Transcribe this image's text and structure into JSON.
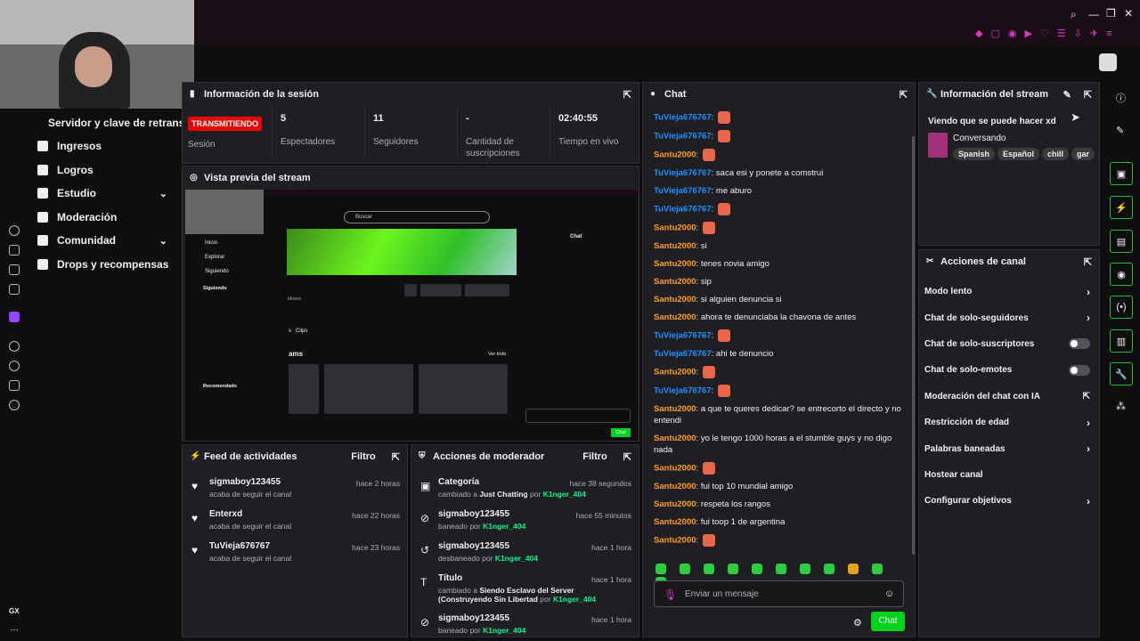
{
  "sidebar": {
    "header": "Servidor y clave de retransm",
    "items": [
      {
        "label": "Ingresos",
        "icon": "revenue-icon"
      },
      {
        "label": "Logros",
        "icon": "trophy-icon"
      },
      {
        "label": "Estudio",
        "icon": "studio-icon",
        "expandable": true
      },
      {
        "label": "Moderación",
        "icon": "wrench-icon"
      },
      {
        "label": "Comunidad",
        "icon": "community-icon",
        "expandable": true
      },
      {
        "label": "Drops y recompensas",
        "icon": "drops-icon"
      }
    ]
  },
  "session": {
    "title": "Información de la sesión",
    "badge": "TRANSMITIENDO",
    "badge_label": "Sesión",
    "stats": [
      {
        "value": "5",
        "label": "Espectadores"
      },
      {
        "value": "11",
        "label": "Seguidores"
      },
      {
        "value": "-",
        "label": "Cantidad de suscripciones"
      },
      {
        "value": "02:40:55",
        "label": "Tiempo en vivo"
      }
    ]
  },
  "preview": {
    "title": "Vista previa del stream",
    "search": "Buscar",
    "nav": [
      "Inicio",
      "Explorar",
      "Siguiendo"
    ],
    "section1": "Siguiendo",
    "section2": "Recomendado",
    "chat": "Chat",
    "clips": "Clips",
    "ams": "ams",
    "ver_todo": "Ver todo",
    "viewers": "idores",
    "chat_btn": "Chat"
  },
  "feed": {
    "title": "Feed de actividades",
    "filter": "Filtro",
    "rows": [
      {
        "name": "sigmaboy123455",
        "desc": "acaba de seguir el canal",
        "time": "hace 2 horas"
      },
      {
        "name": "Enterxd",
        "desc": "acaba de seguir el canal",
        "time": "hace 22 horas"
      },
      {
        "name": "TuVieja676767",
        "desc": "acaba de seguir el canal",
        "time": "hace 23 horas"
      }
    ]
  },
  "modactions": {
    "title": "Acciones de moderador",
    "filter": "Filtro",
    "rows": [
      {
        "name": "Categoría",
        "desc_pre": "cambiado a ",
        "desc_hl": "Just Chatting",
        "desc_mid": " por ",
        "desc_by": "K1nger_404",
        "time": "hace 38 segundos"
      },
      {
        "name": "sigmaboy123455",
        "desc_pre": "baneado por ",
        "desc_by": "K1nger_404",
        "time": "hace 55 minutos"
      },
      {
        "name": "sigmaboy123455",
        "desc_pre": "desbaneado por ",
        "desc_by": "K1nger_404",
        "time": "hace 1 hora"
      },
      {
        "name": "Título",
        "desc_pre": "cambiado a ",
        "desc_hl": "Siendo Esclavo del Server",
        "desc_line2": "(Construyendo Sin Libertad",
        "desc_mid": " por ",
        "desc_by": "K1nger_404",
        "time": "hace 1 hora"
      },
      {
        "name": "sigmaboy123455",
        "desc_pre": "baneado por ",
        "desc_by": "K1nger_404",
        "time": "hace 1 hora"
      }
    ]
  },
  "chat": {
    "title": "Chat",
    "placeholder": "Enviar un mensaje",
    "send": "Chat",
    "messages": [
      {
        "user": "TuVieja676767",
        "text": "",
        "color": "#1e90ff",
        "emote": true
      },
      {
        "user": "TuVieja676767",
        "text": "",
        "color": "#1e90ff",
        "emote": true
      },
      {
        "user": "Santu2000",
        "text": "",
        "color": "#ff9f1c",
        "emote": true
      },
      {
        "user": "TuVieja676767",
        "text": "saca esi y ponete a comstrui",
        "color": "#1e90ff"
      },
      {
        "user": "TuVieja676767",
        "text": "me aburo",
        "color": "#1e90ff"
      },
      {
        "user": "TuVieja676767",
        "text": "",
        "color": "#1e90ff",
        "emote": true
      },
      {
        "user": "Santu2000",
        "text": "",
        "color": "#ff9f1c",
        "emote": true
      },
      {
        "user": "Santu2000",
        "text": "si",
        "color": "#ff9f1c"
      },
      {
        "user": "Santu2000",
        "text": "tenes novia amigo",
        "color": "#ff9f1c"
      },
      {
        "user": "Santu2000",
        "text": "sip",
        "color": "#ff9f1c"
      },
      {
        "user": "Santu2000",
        "text": "si alguien denuncia si",
        "color": "#ff9f1c"
      },
      {
        "user": "Santu2000",
        "text": "ahora te denunciaba la chavona de antes",
        "color": "#ff9f1c"
      },
      {
        "user": "TuVieja676767",
        "text": "",
        "color": "#1e90ff",
        "emote": true
      },
      {
        "user": "TuVieja676767",
        "text": "ahi te denuncio",
        "color": "#1e90ff"
      },
      {
        "user": "Santu2000",
        "text": "",
        "color": "#ff9f1c",
        "emote": true
      },
      {
        "user": "TuVieja676767",
        "text": "",
        "color": "#1e90ff",
        "emote": true
      },
      {
        "user": "Santu2000",
        "text": "a que te queres dedicar? se entrecorto el directo y no entendi",
        "color": "#ff9f1c"
      },
      {
        "user": "Santu2000",
        "text": "yo le tengo 1000 horas a el stumble guys y no digo nada",
        "color": "#ff9f1c"
      },
      {
        "user": "Santu2000",
        "text": "",
        "color": "#ff9f1c",
        "emote": true
      },
      {
        "user": "Santu2000",
        "text": "fui top 10 mundial amigo",
        "color": "#ff9f1c"
      },
      {
        "user": "Santu2000",
        "text": "respeta los rangos",
        "color": "#ff9f1c"
      },
      {
        "user": "Santu2000",
        "text": "fui toop 1 de argentina",
        "color": "#ff9f1c"
      },
      {
        "user": "Santu2000",
        "text": "",
        "color": "#ff9f1c",
        "emote": true
      }
    ]
  },
  "stream_info": {
    "title": "Información del stream",
    "stream_title": "Viendo que se puede hacer xd",
    "category": "Conversando",
    "tags": [
      "Spanish",
      "Español",
      "chill",
      "gar"
    ]
  },
  "channel_actions": {
    "title": "Acciones de canal",
    "items": [
      {
        "label": "Modo lento",
        "kind": "chevron"
      },
      {
        "label": "Chat de solo-seguidores",
        "kind": "chevron"
      },
      {
        "label": "Chat de solo-suscriptores",
        "kind": "toggle"
      },
      {
        "label": "Chat de solo-emotes",
        "kind": "toggle"
      },
      {
        "label": "Moderación del chat con IA",
        "kind": "popout"
      },
      {
        "label": "Restricción de edad",
        "kind": "chevron"
      },
      {
        "label": "Palabras baneadas",
        "kind": "chevron"
      },
      {
        "label": "Hostear canal",
        "kind": "none"
      },
      {
        "label": "Configurar objetivos",
        "kind": "chevron"
      }
    ]
  },
  "colors": {
    "accent": "#1fbf3a",
    "live": "#eb0400",
    "mention": "#00f593"
  }
}
